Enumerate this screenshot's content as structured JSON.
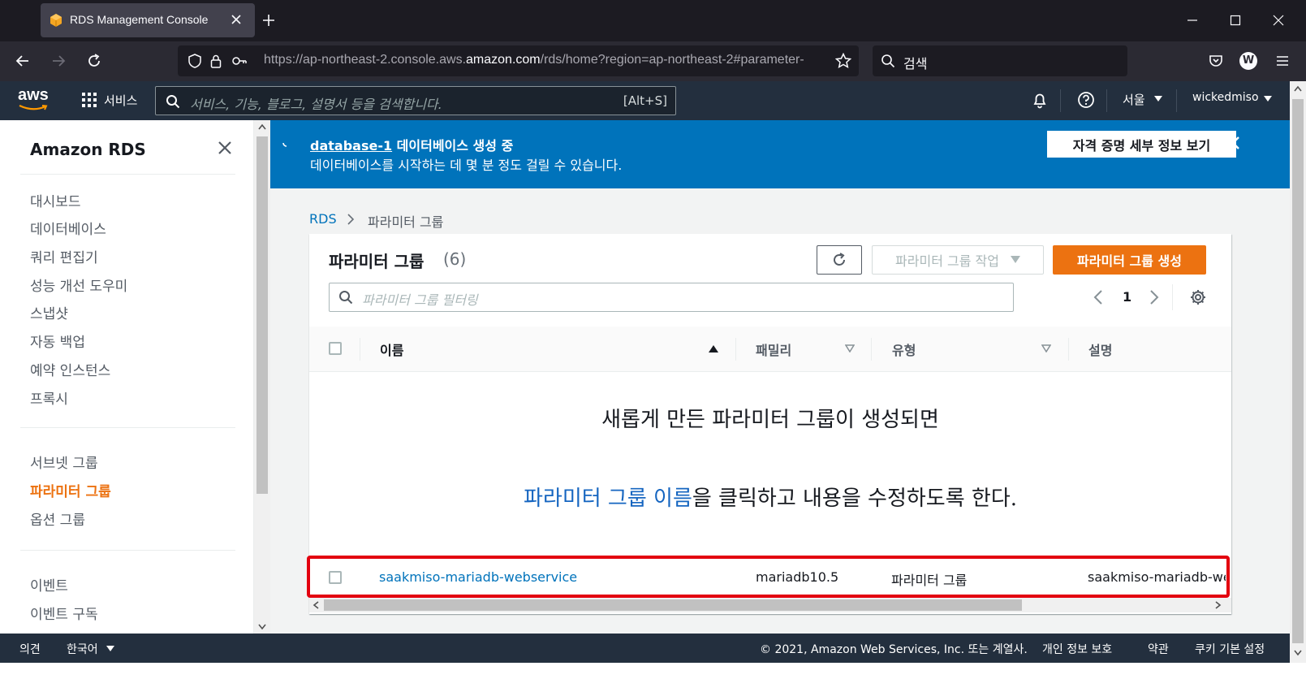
{
  "browser": {
    "tab_title": "RDS Management Console",
    "url_prefix": "https://ap-northeast-2.console.aws.",
    "url_domain": "amazon.com",
    "url_suffix": "/rds/home?region=ap-northeast-2#parameter-",
    "search_placeholder": "검색",
    "profile_initial": "W"
  },
  "aws_header": {
    "logo": "aws",
    "services_label": "서비스",
    "search_placeholder": "서비스, 기능, 블로그, 설명서 등을 검색합니다.",
    "search_shortcut": "[Alt+S]",
    "region_label": "서울",
    "user_label": "wickedmiso"
  },
  "sidebar": {
    "title": "Amazon RDS",
    "group1": [
      "대시보드",
      "데이터베이스",
      "쿼리 편집기",
      "성능 개선 도우미",
      "스냅샷",
      "자동 백업",
      "예약 인스턴스",
      "프록시"
    ],
    "group2": [
      "서브넷 그룹",
      "파라미터 그룹",
      "옵션 그룹"
    ],
    "group3": [
      "이벤트",
      "이벤트 구독"
    ],
    "active_item": "파라미터 그룹"
  },
  "banner": {
    "db_link": "database-1",
    "title_suffix": "데이터베이스 생성 중",
    "subtitle": "데이터베이스를 시작하는 데 몇 분 정도 걸릴 수 있습니다.",
    "button_label": "자격 증명 세부 정보 보기"
  },
  "breadcrumb": {
    "root": "RDS",
    "current": "파라미터 그룹"
  },
  "panel": {
    "title": "파라미터 그룹",
    "count": "(6)",
    "actions_label": "파라미터 그룹 작업",
    "create_label": "파라미터 그룹 생성",
    "filter_placeholder": "파라미터 그룹 필터링",
    "page_number": "1",
    "columns": [
      "이름",
      "패밀리",
      "유형",
      "설명"
    ]
  },
  "annotation": {
    "line1": "새롭게 만든 파라미터 그룹이 생성되면",
    "line2_highlight": "파라미터 그룹 이름",
    "line2_rest": "을 클릭하고 내용을 수정하도록 한다."
  },
  "rows": [
    {
      "name": "saakmiso-mariadb-webservice",
      "family": "mariadb10.5",
      "type": "파라미터 그룹",
      "description": "saakmiso-mariadb-web"
    }
  ],
  "footer": {
    "feedback": "의견",
    "language": "한국어",
    "copyright": "© 2021, Amazon Web Services, Inc. 또는 계열사.",
    "privacy": "개인 정보 보호",
    "terms": "약관",
    "cookies": "쿠키 기본 설정"
  },
  "colors": {
    "aws_header": "#232f3e",
    "banner": "#0073bb",
    "primary": "#ec7211",
    "link": "#0073bb",
    "highlight_box": "#e3000f"
  }
}
